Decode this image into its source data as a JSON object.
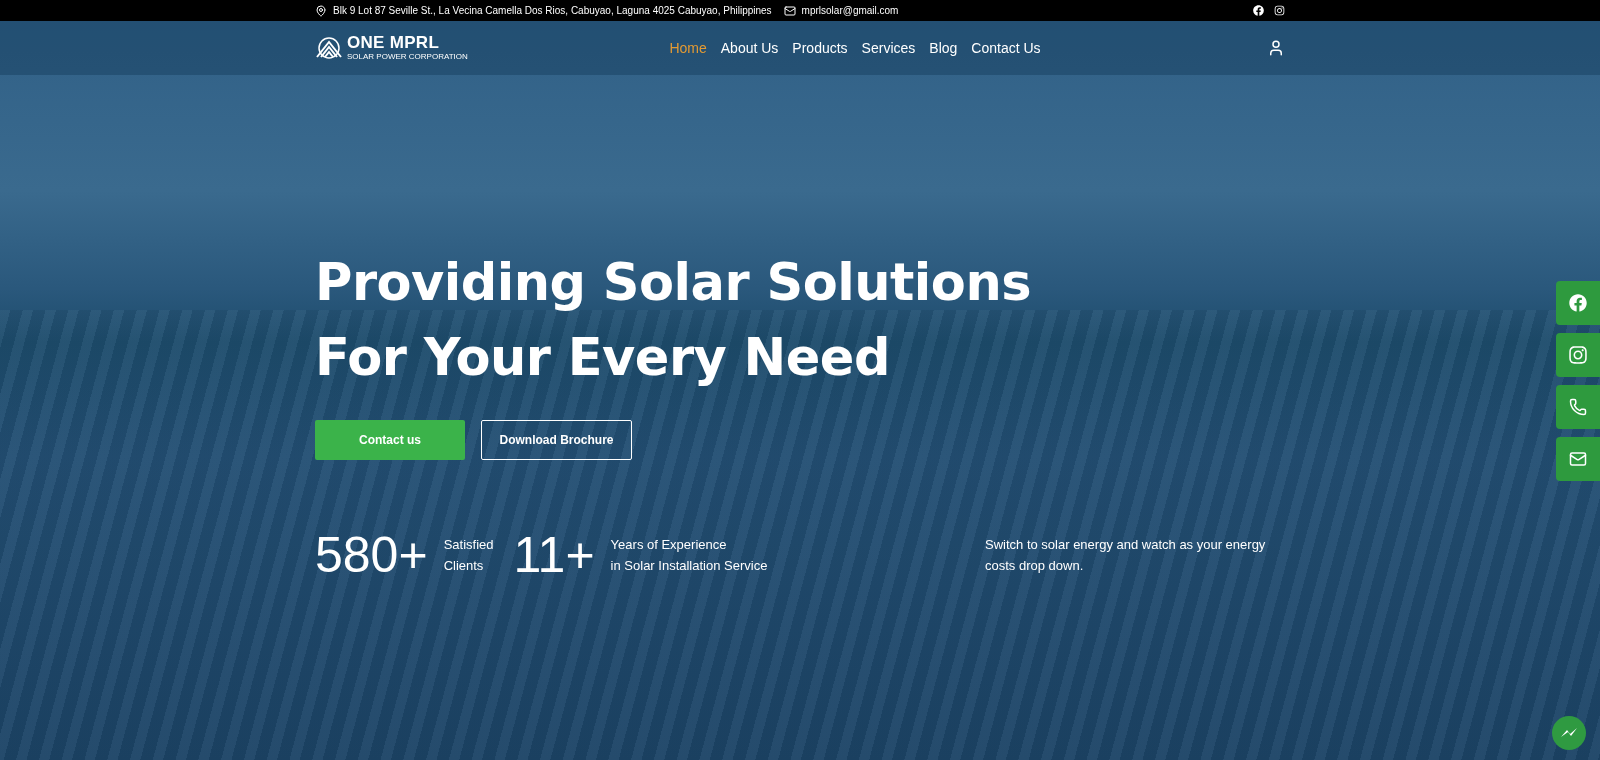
{
  "top_bar": {
    "address": "Blk 9 Lot 87 Seville St., La Vecina Camella Dos Rios, Cabuyao, Laguna 4025 Cabuyao, Philippines",
    "email": "mprlsolar@gmail.com"
  },
  "logo": {
    "name": "ONE MPRL",
    "tagline": "SOLAR POWER CORPORATION"
  },
  "nav": [
    {
      "label": "Home",
      "selected": true
    },
    {
      "label": "About Us",
      "selected": false
    },
    {
      "label": "Products",
      "selected": false
    },
    {
      "label": "Services",
      "selected": false
    },
    {
      "label": "Blog",
      "selected": false
    },
    {
      "label": "Contact Us",
      "selected": false
    }
  ],
  "hero": {
    "heading_lines": [
      "Providing Solar Solutions",
      "For Your Every Need"
    ],
    "buttons": [
      {
        "label": "Contact us",
        "kind": "primary"
      },
      {
        "label": "Download Brochure",
        "kind": "outline"
      }
    ],
    "stats": [
      {
        "value": "580+",
        "label_lines": [
          "Satisfied",
          "Clients"
        ]
      },
      {
        "value": "11+",
        "label_lines": [
          "Years of Experience",
          "in Solar Installation Service"
        ]
      }
    ],
    "tagline_lines": [
      "Switch to solar energy and watch as your energy",
      "costs drop down."
    ]
  }
}
